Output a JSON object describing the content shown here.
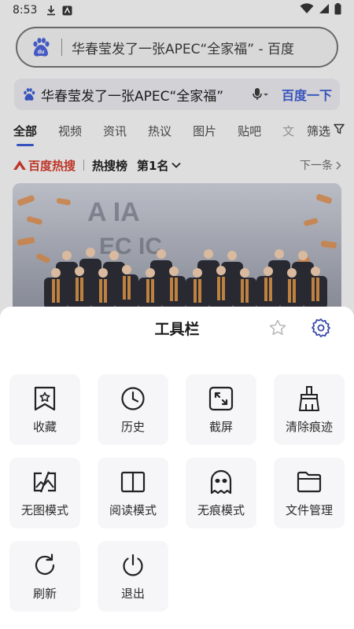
{
  "status_bar": {
    "time": "8:53"
  },
  "address_bar": {
    "url_title": "华春莹发了一张APEC“全家福” - 百度"
  },
  "search": {
    "query": "华春莹发了一张APEC“全家福”",
    "button": "百度一下"
  },
  "tabs": [
    "全部",
    "视频",
    "资讯",
    "热议",
    "图片",
    "贴吧",
    "文"
  ],
  "filter_label": "筛选",
  "hot": {
    "brand": "百度热搜",
    "board": "热搜榜",
    "rank": "第1名",
    "next": "下一条"
  },
  "toolbar": {
    "title": "工具栏",
    "items": [
      {
        "label": "收藏",
        "icon": "bookmark-star-icon"
      },
      {
        "label": "历史",
        "icon": "clock-icon"
      },
      {
        "label": "截屏",
        "icon": "screenshot-icon"
      },
      {
        "label": "清除痕迹",
        "icon": "broom-icon"
      },
      {
        "label": "无图模式",
        "icon": "no-image-icon"
      },
      {
        "label": "阅读模式",
        "icon": "book-icon"
      },
      {
        "label": "无痕模式",
        "icon": "ghost-icon"
      },
      {
        "label": "文件管理",
        "icon": "folder-icon"
      },
      {
        "label": "刷新",
        "icon": "refresh-icon"
      },
      {
        "label": "退出",
        "icon": "power-icon"
      }
    ]
  },
  "colors": {
    "accent": "#3b59c8",
    "hot_red": "#c93b2c",
    "sheet_bg": "#ffffff",
    "tile_bg": "#f6f6f8"
  }
}
